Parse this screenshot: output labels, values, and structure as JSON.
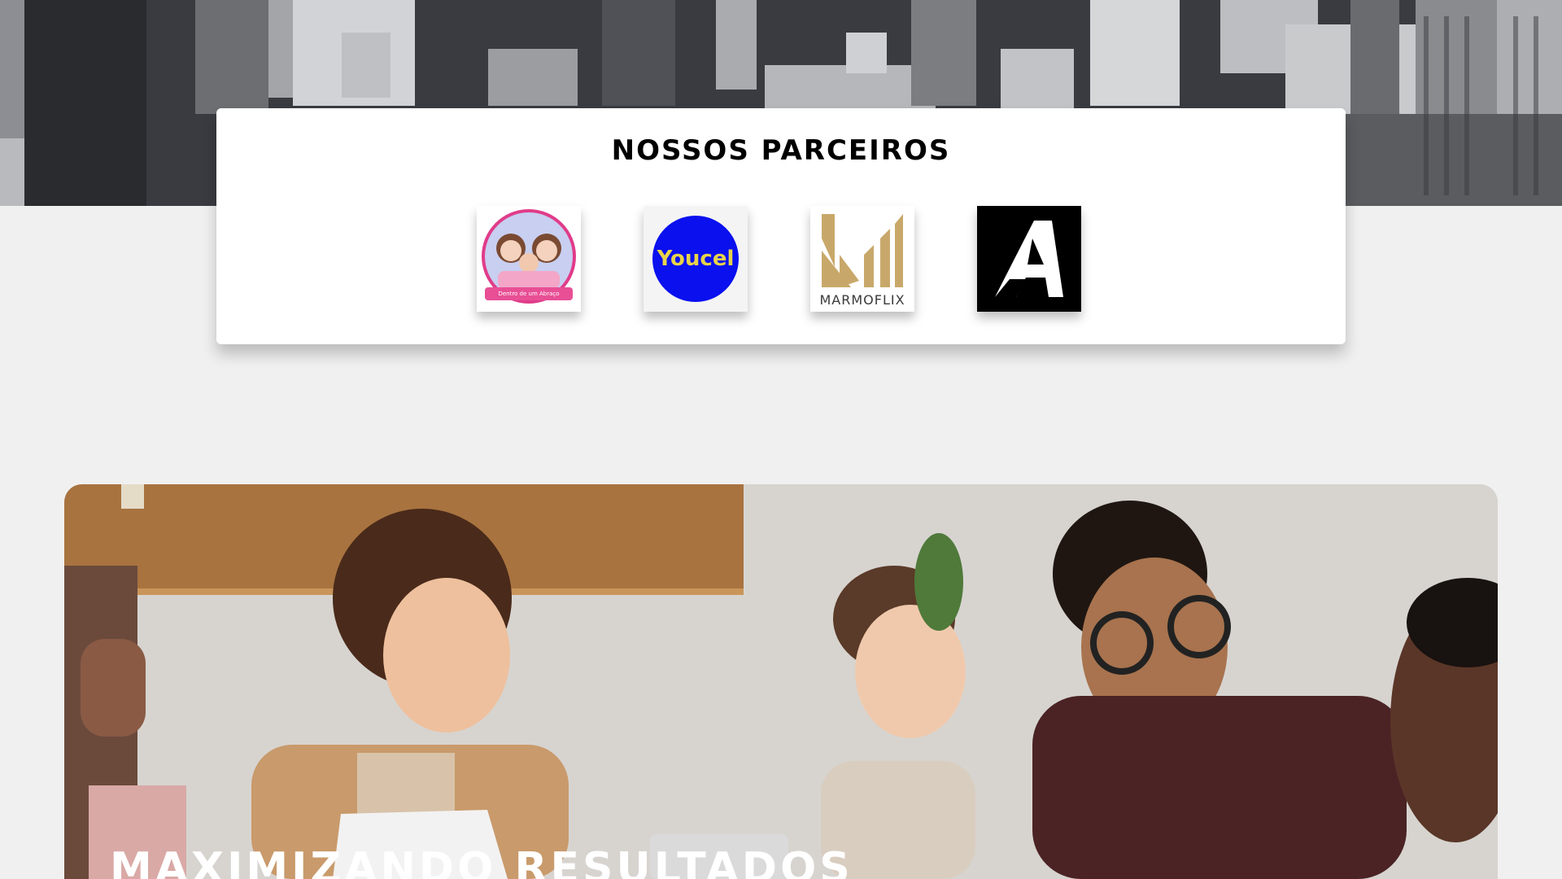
{
  "partners": {
    "title": "NOSSOS PARCEIROS",
    "logos": [
      {
        "name": "Dentro de um Abraço",
        "caption": "Dentro de um Abraço",
        "icon": "dentro-de-um-abraco-logo"
      },
      {
        "name": "Youcel",
        "caption": "Youcel",
        "icon": "youcel-logo",
        "color": "#0a10ee"
      },
      {
        "name": "Marmoflix",
        "caption": "MARMOFLIX",
        "icon": "marmoflix-logo",
        "color": "#c8a86a"
      },
      {
        "name": "A",
        "caption": "A",
        "icon": "a-letter-logo",
        "color": "#000000"
      }
    ]
  },
  "hero": {
    "title": "MAXIMIZANDO RESULTADOS"
  },
  "colors": {
    "page_background": "#f0f0f0",
    "card_background": "#ffffff"
  }
}
